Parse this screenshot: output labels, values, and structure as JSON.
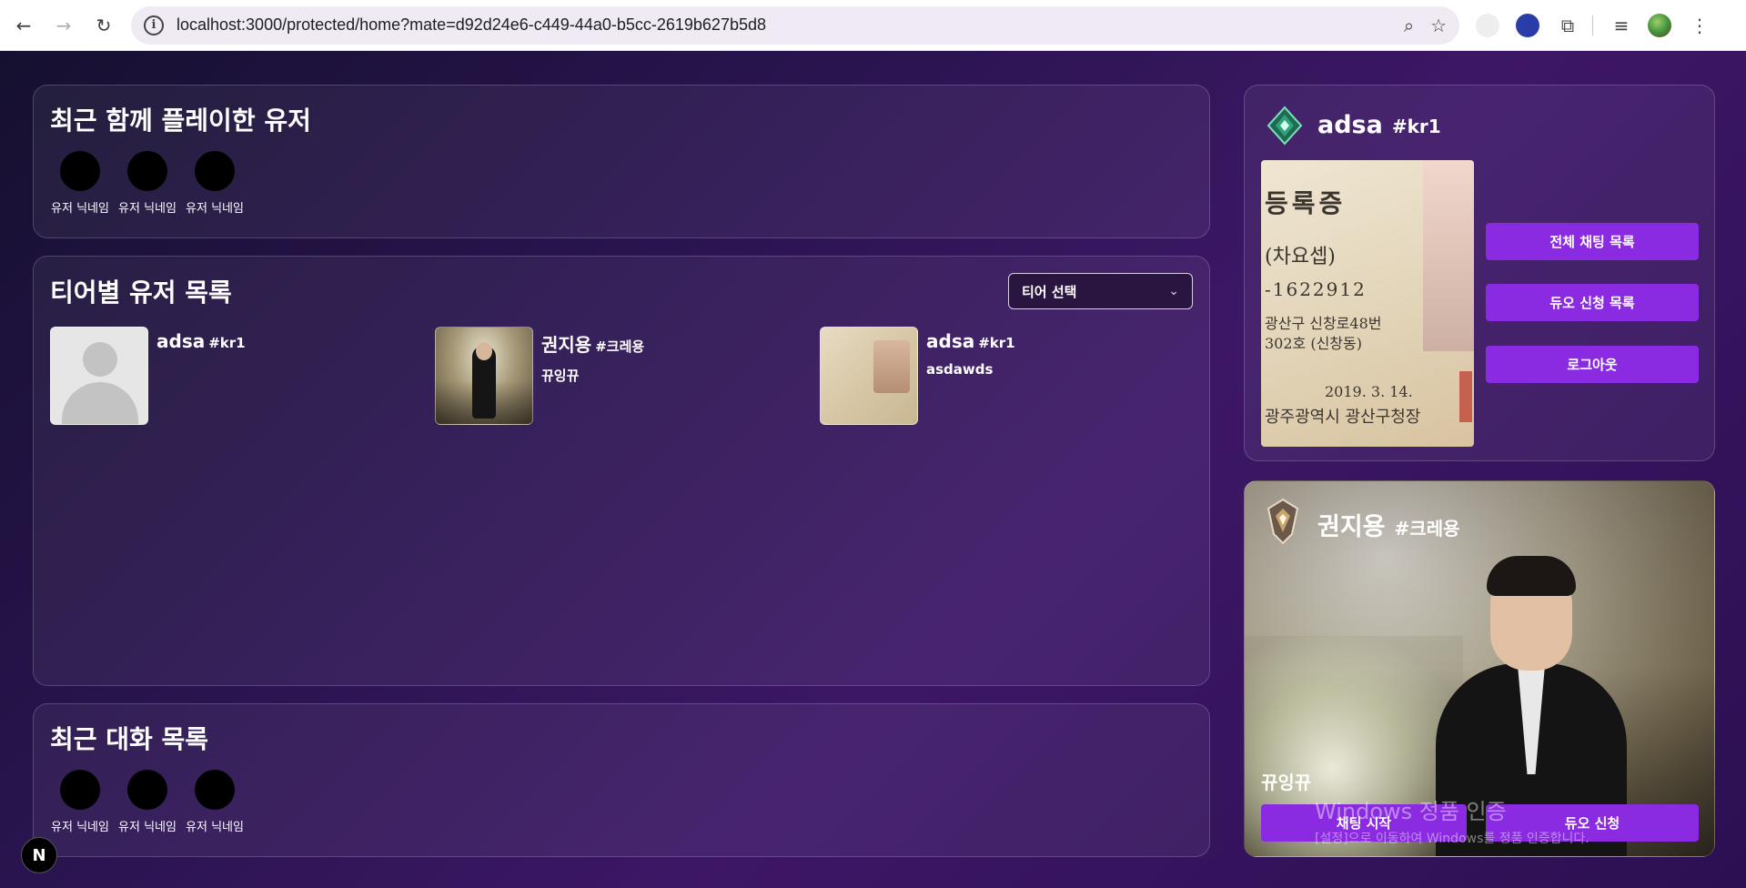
{
  "browser": {
    "url": "localhost:3000/protected/home?mate=d92d24e6-c449-44a0-b5cc-2619b627b5d8",
    "icons": [
      "back-icon",
      "forward-icon",
      "reload-icon",
      "site-info-icon",
      "zoom-icon",
      "bookmark-star-icon",
      "extension-icon",
      "puzzle-icon",
      "media-icon",
      "profile-avatar"
    ]
  },
  "recent_played": {
    "title": "최근 함께 플레이한 유저",
    "users": [
      "유저 닉네임",
      "유저 닉네임",
      "유저 닉네임"
    ]
  },
  "tier_list": {
    "title": "티어별 유저 목록",
    "select_label": "티어 선택",
    "users": [
      {
        "name": "adsa",
        "tag": "#kr1",
        "sub": ""
      },
      {
        "name": "권지용",
        "tag": "#크레용",
        "sub": "뀨잉뀨"
      },
      {
        "name": "adsa",
        "tag": "#kr1",
        "sub": "asdawds"
      }
    ]
  },
  "recent_chats": {
    "title": "최근 대화 목록",
    "users": [
      "유저 닉네임",
      "유저 닉네임",
      "유저 닉네임"
    ]
  },
  "my_profile": {
    "name": "adsa",
    "tag": "#kr1",
    "buttons": {
      "all_chats": "전체 채팅 목록",
      "duo_requests": "듀오 신청 목록",
      "logout": "로그아웃"
    },
    "photo_text": [
      "등록증",
      "(차요셉)",
      "-1622912",
      "광산구 신창로48번",
      "302호 (신창동)",
      "2019. 3. 14.",
      "광주광역시 광산구청장"
    ]
  },
  "mate_card": {
    "name": "권지용",
    "tag": "#크레용",
    "nickname": "뀨잉뀨",
    "buttons": {
      "chat_start": "채팅 시작",
      "duo_request": "듀오 신청"
    }
  },
  "watermark": {
    "title": "Windows 정품 인증",
    "subtitle": "[설정]으로 이동하여 Windows를 정품 인증합니다."
  },
  "dev_badge": "N",
  "colors": {
    "accent": "#8a2be2",
    "background": "#2a1450"
  }
}
